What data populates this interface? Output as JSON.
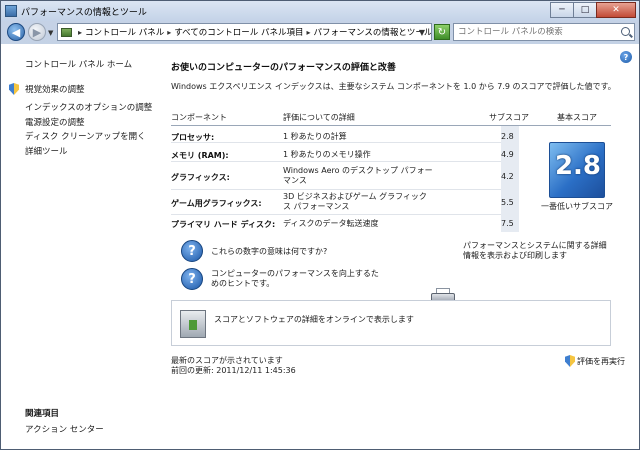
{
  "window": {
    "title": "パフォーマンスの情報とツール",
    "controls": {
      "minimize": "─",
      "maximize": "□",
      "close": "✕"
    }
  },
  "navigation": {
    "breadcrumbs": [
      "コントロール パネル",
      "すべてのコントロール パネル項目",
      "パフォーマンスの情報とツール"
    ],
    "search_placeholder": "コントロール パネルの検索"
  },
  "sidebar": {
    "home": "コントロール パネル ホーム",
    "links": [
      "視覚効果の調整",
      "インデックスのオプションの調整",
      "電源設定の調整",
      "ディスク クリーンアップを開く",
      "詳細ツール"
    ],
    "related_title": "関連項目",
    "related_links": [
      "アクション センター"
    ]
  },
  "main": {
    "heading": "お使いのコンピューターのパフォーマンスの評価と改善",
    "intro": "Windows エクスペリエンス インデックスは、主要なシステム コンポーネントを 1.0 から 7.9 のスコアで評価した値です。",
    "table": {
      "headers": {
        "component": "コンポーネント",
        "detail": "評価についての詳細",
        "subscore": "サブスコア",
        "base": "基本スコア"
      },
      "rows": [
        {
          "component": "プロセッサ:",
          "detail": "1 秒あたりの計算",
          "subscore": "2.8"
        },
        {
          "component": "メモリ (RAM):",
          "detail": "1 秒あたりのメモリ操作",
          "subscore": "4.9"
        },
        {
          "component": "グラフィックス:",
          "detail": "Windows Aero のデスクトップ パフォーマンス",
          "subscore": "4.2"
        },
        {
          "component": "ゲーム用グラフィックス:",
          "detail": "3D ビジネスおよびゲーム グラフィックス パフォーマンス",
          "subscore": "5.5"
        },
        {
          "component": "プライマリ ハード ディスク:",
          "detail": "ディスクのデータ転送速度",
          "subscore": "7.5"
        }
      ],
      "base_score": "2.8",
      "base_caption": "一番低いサブスコア"
    },
    "info_links": {
      "meaning": "これらの数字の意味は何ですか?",
      "improve": "コンピューターのパフォーマンスを向上するためのヒントです。",
      "print": "パフォーマンスとシステムに関する詳細情報を表示および印刷します"
    },
    "online": "スコアとソフトウェアの詳細をオンラインで表示します",
    "status": {
      "current": "最新のスコアが示されています",
      "last_update": "前回の更新: 2011/12/11 1:45:36"
    },
    "rerun": "評価を再実行"
  }
}
